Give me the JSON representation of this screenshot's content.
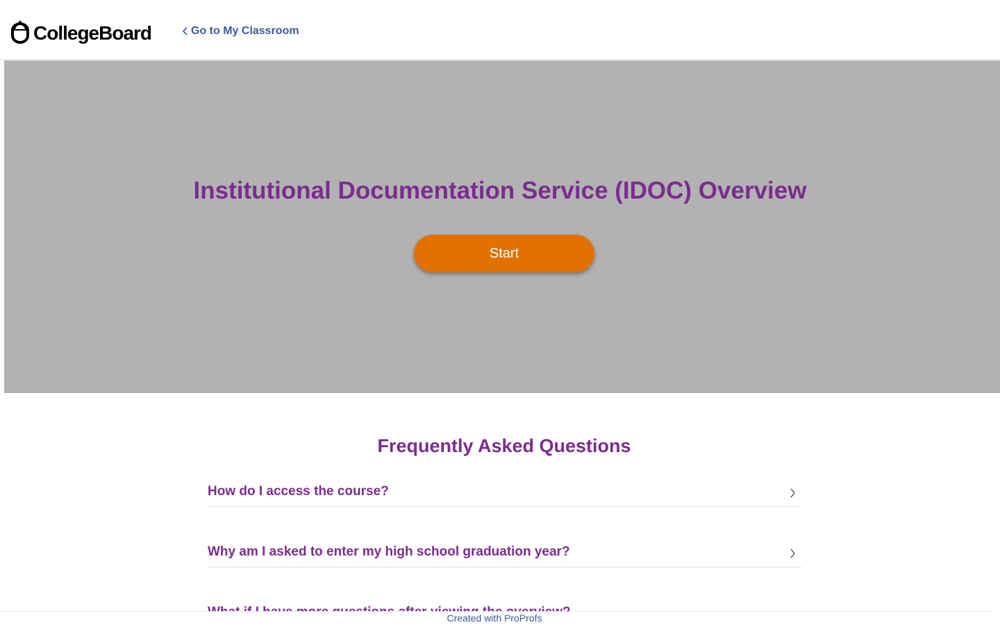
{
  "header": {
    "logo_text": "CollegeBoard",
    "back_link_label": "Go to My Classroom"
  },
  "hero": {
    "title": "Institutional Documentation Service (IDOC) Overview",
    "start_label": "Start",
    "background_color": "#b2b2b2",
    "title_color": "#7b2c8f",
    "button_color": "#e37100"
  },
  "faq": {
    "title": "Frequently Asked Questions",
    "items": [
      {
        "question": "How do I access the course?"
      },
      {
        "question": "Why am I asked to enter my high school graduation year?"
      },
      {
        "question": "What if I have more questions after viewing the overview?"
      }
    ]
  },
  "footer": {
    "text": "Created with ProProfs"
  },
  "icons": {
    "logo": "acorn-icon",
    "back": "chevron-left-icon",
    "expand": "chevron-right-icon"
  }
}
